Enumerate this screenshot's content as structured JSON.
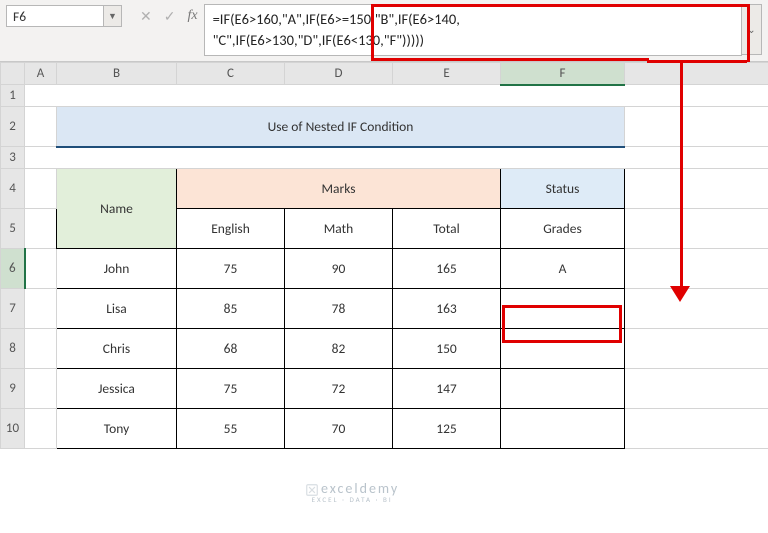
{
  "namebox": {
    "value": "F6"
  },
  "formula_bar": {
    "l1": "=IF(E6>160,\"A\",IF(E6>=150,\"B\",IF(E6>140,",
    "l2": "\"C\",IF(E6>130,\"D\",IF(E6<130,\"F\")))))"
  },
  "columns": [
    "A",
    "B",
    "C",
    "D",
    "E",
    "F"
  ],
  "rows": [
    "1",
    "2",
    "3",
    "4",
    "5",
    "6",
    "7",
    "8",
    "9",
    "10"
  ],
  "title": "Use of Nested IF Condition",
  "headers": {
    "name": "Name",
    "marks": "Marks",
    "status": "Status",
    "english": "English",
    "math": "Math",
    "total": "Total",
    "grades": "Grades"
  },
  "chart_data": {
    "type": "table",
    "columns": [
      "Name",
      "English",
      "Math",
      "Total",
      "Grades"
    ],
    "rows": [
      {
        "name": "John",
        "english": 75,
        "math": 90,
        "total": 165,
        "grade": "A"
      },
      {
        "name": "Lisa",
        "english": 85,
        "math": 78,
        "total": 163,
        "grade": ""
      },
      {
        "name": "Chris",
        "english": 68,
        "math": 82,
        "total": 150,
        "grade": ""
      },
      {
        "name": "Jessica",
        "english": 75,
        "math": 72,
        "total": 147,
        "grade": ""
      },
      {
        "name": "Tony",
        "english": 55,
        "math": 70,
        "total": 125,
        "grade": ""
      }
    ]
  },
  "watermark": {
    "main": "exceldemy",
    "sub": "EXCEL · DATA · BI"
  }
}
